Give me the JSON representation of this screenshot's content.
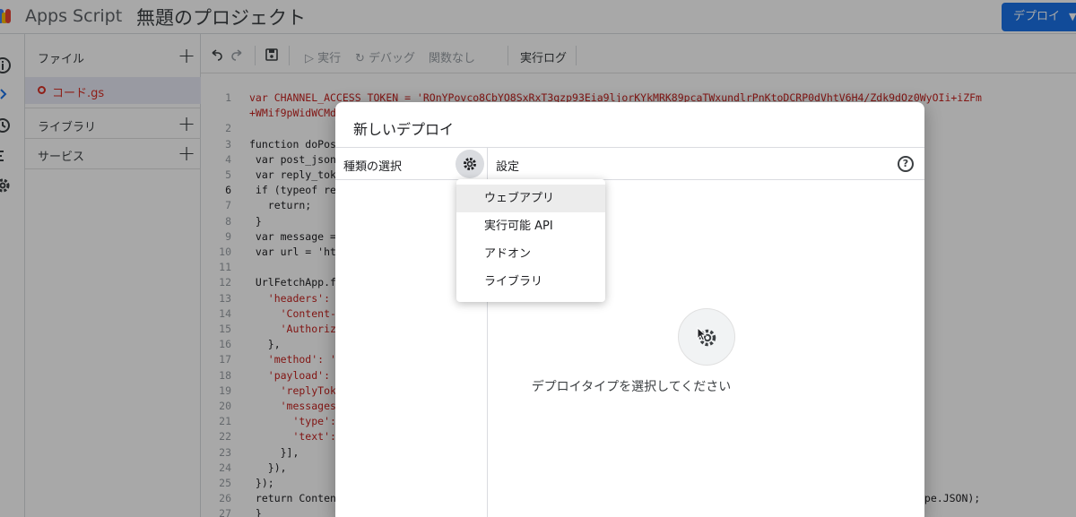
{
  "app": {
    "name": "Apps Script",
    "project_title": "無題のプロジェクト"
  },
  "header": {
    "deploy_label": "デプロイ",
    "deploy_caret": "▼"
  },
  "sidebar": {
    "files_label": "ファイル",
    "file_name": "コード.gs",
    "libraries_label": "ライブラリ",
    "services_label": "サービス",
    "plus": "+"
  },
  "toolbar": {
    "run_label": "実行",
    "debug_label": "デバッグ",
    "function_label": "関数なし",
    "log_label": "実行ログ"
  },
  "editor": {
    "line_numbers": [
      "1",
      "",
      "2",
      "3",
      "4",
      "5",
      "6",
      "7",
      "8",
      "9",
      "10",
      "11",
      "12",
      "13",
      "14",
      "15",
      "16",
      "17",
      "18",
      "19",
      "20",
      "21",
      "22",
      "23",
      "24",
      "25",
      "26",
      "27"
    ],
    "active_line": "6",
    "lines": [
      "var CHANNEL_ACCESS_TOKEN = 'ROnYPovco8CbYO8SxRxT3qzp93Eia9ljorKYkMRK89pcaTWxundlrPnKtoDCRP0dVhtV6H4/Zdk9dOz0WyOIi+iZFm",
      "+WMif9pWidWCMd",
      "",
      "function doPos",
      " var post_json",
      " var reply_tok",
      " if (typeof re",
      "   return;",
      " }",
      " var message =",
      " var url = 'ht",
      "",
      " UrlFetchApp.f",
      "   'headers':",
      "     'Content-",
      "     'Authoriz",
      "   },",
      "   'method': '",
      "   'payload':",
      "     'replyTok",
      "     'messages",
      "       'type':",
      "       'text':",
      "     }],",
      "   }),",
      " });",
      " return Conten",
      " }"
    ],
    "tail_text": "ype.JSON);"
  },
  "dialog": {
    "title": "新しいデプロイ",
    "type_select_label": "種類の選択",
    "settings_label": "設定",
    "help_glyph": "?",
    "empty_message": "デプロイタイプを選択してください"
  },
  "dropdown": {
    "items": [
      "ウェブアプリ",
      "実行可能 API",
      "アドオン",
      "ライブラリ"
    ],
    "highlighted_index": 0
  }
}
